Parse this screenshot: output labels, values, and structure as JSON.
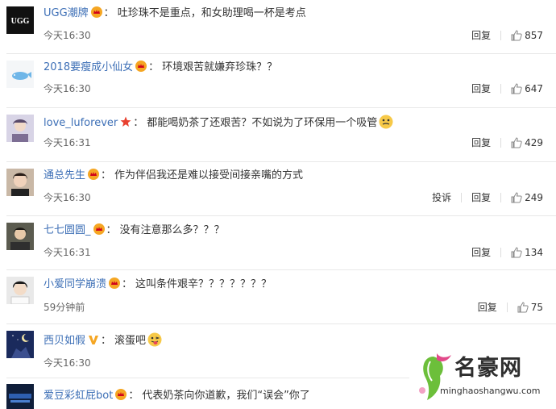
{
  "colors": {
    "username": "#3d6fb6",
    "divider": "#e8e8e8",
    "badge": "#f5a623"
  },
  "comments": [
    {
      "username": "UGG潮牌",
      "text": "吐珍珠不是重点，和女助理喝一杯是考点",
      "time": "今天16:30",
      "reply": "回复",
      "likes": "857",
      "badge": "crown"
    },
    {
      "username": "2018要瘦成小仙女",
      "text": "环境艰苦就嫌弃珍珠？？",
      "time": "今天16:30",
      "reply": "回复",
      "likes": "647",
      "badge": "crown"
    },
    {
      "username": "love_luforever",
      "text": "都能喝奶茶了还艰苦？不如说为了环保用一个吸管",
      "time": "今天16:31",
      "reply": "回复",
      "likes": "429",
      "badge": "star",
      "emoji": "grimace-emoji"
    },
    {
      "username": "通总先生",
      "text": "作为伴侣我还是难以接受间接亲嘴的方式",
      "time": "今天16:30",
      "report": "投诉",
      "reply": "回复",
      "likes": "249",
      "badge": "crown"
    },
    {
      "username": "七七圆圆_",
      "text": "没有注意那么多？？？",
      "time": "今天16:31",
      "reply": "回复",
      "likes": "134",
      "badge": "crown"
    },
    {
      "username": "小爱同学崩溃",
      "text": "这叫条件艰辛？？？？？？？",
      "time": "59分钟前",
      "reply": "回复",
      "likes": "75",
      "badge": "crown"
    },
    {
      "username": "西贝如假",
      "text": "滚蛋吧",
      "time": "今天16:30",
      "badge": "v",
      "emoji": "tongue-emoji"
    },
    {
      "username": "爱豆彩虹屁bot",
      "text": "代表奶茶向你道歉，我们“误会”你了",
      "badge": "crown"
    }
  ],
  "watermark": {
    "title": "名豪网",
    "subtitle": "minghaoshangwu.com"
  }
}
